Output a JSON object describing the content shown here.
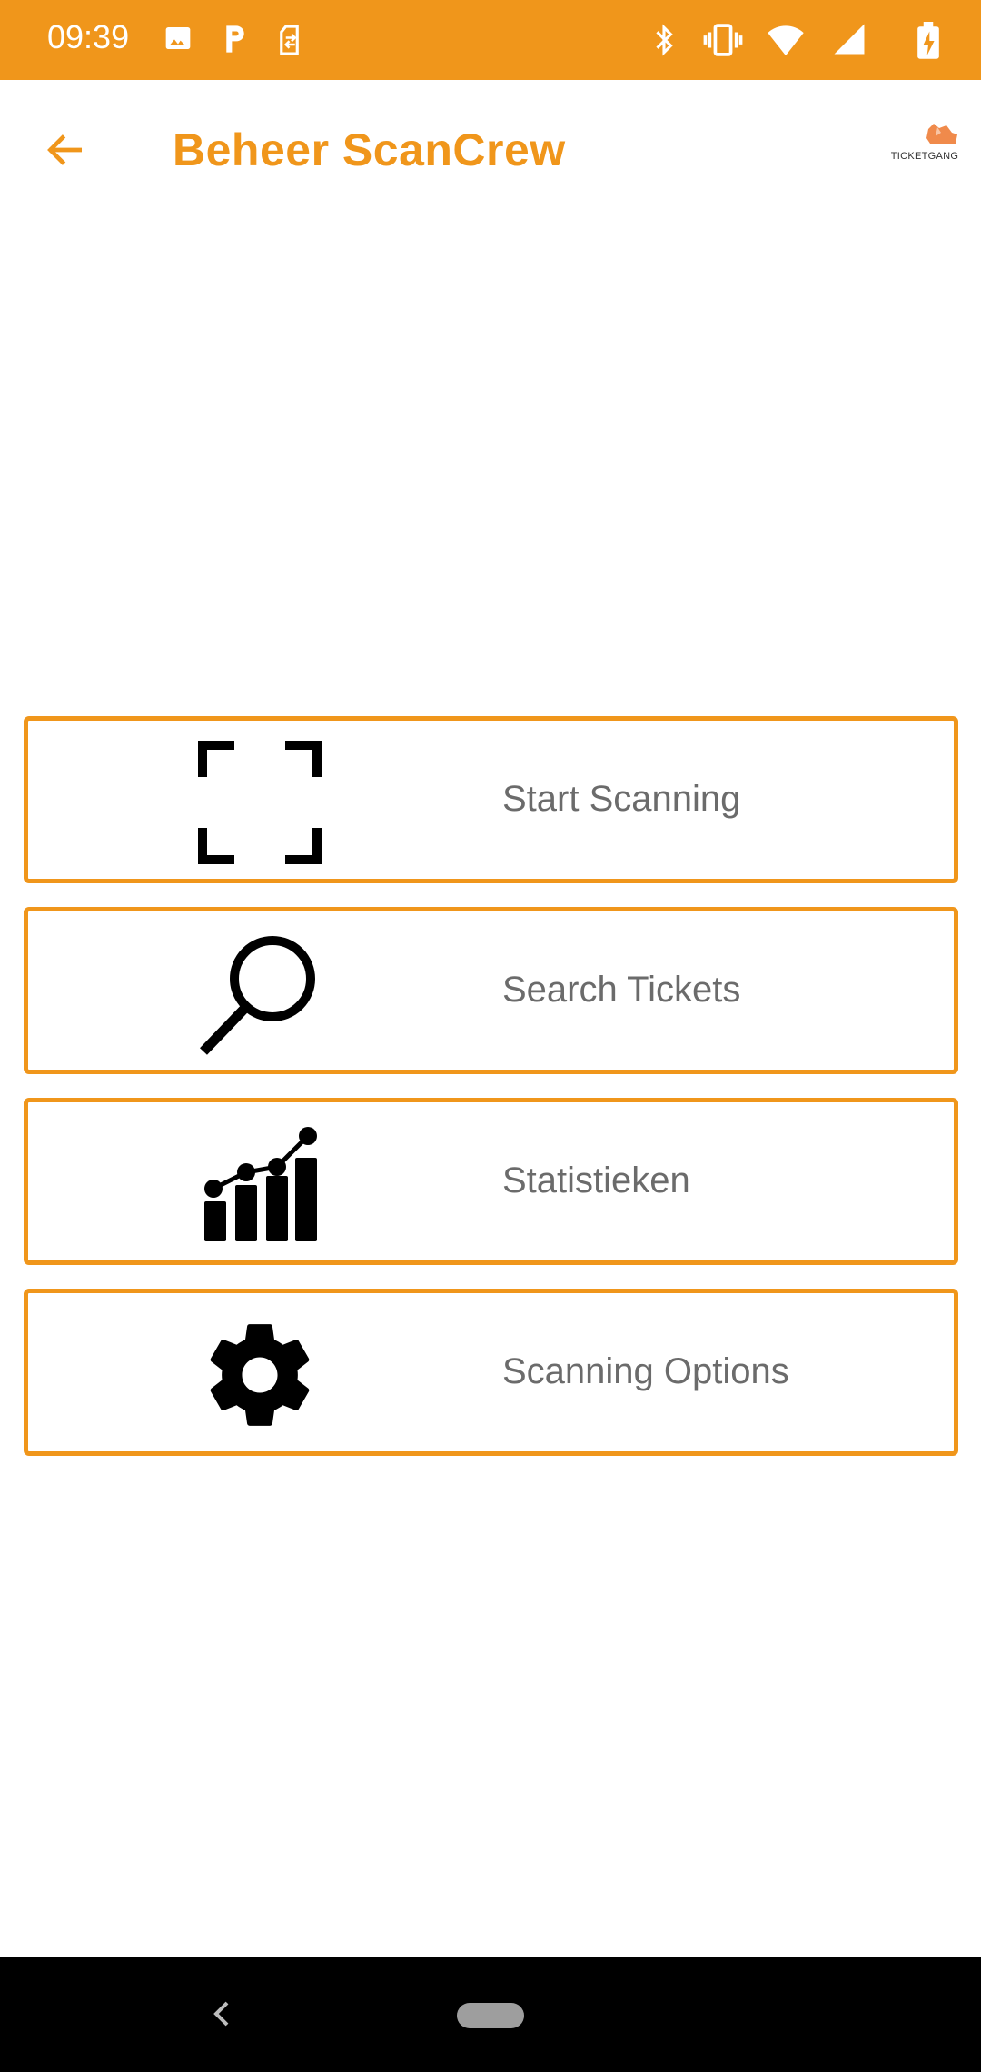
{
  "status_bar": {
    "time": "09:39",
    "left_icons": [
      "image-icon",
      "parking-icon",
      "sim-transfer-icon"
    ],
    "right_icons": [
      "bluetooth-icon",
      "vibrate-icon",
      "wifi-icon",
      "cell-signal-icon",
      "battery-charging-icon"
    ],
    "background_color": "#F0961B"
  },
  "app_bar": {
    "title": "Beheer ScanCrew",
    "back_icon": "arrow-left-icon",
    "logo_text": "TICKETGANG",
    "accent_color": "#F0961B"
  },
  "menu": {
    "items": [
      {
        "label": "Start Scanning",
        "icon": "scan-frame-icon"
      },
      {
        "label": "Search Tickets",
        "icon": "search-icon"
      },
      {
        "label": "Statistieken",
        "icon": "statistics-chart-icon"
      },
      {
        "label": "Scanning Options",
        "icon": "gear-icon"
      }
    ],
    "border_color": "#F0961B"
  },
  "nav_bar": {
    "back_icon": "chevron-left-icon",
    "home_icon": "home-pill-icon"
  }
}
